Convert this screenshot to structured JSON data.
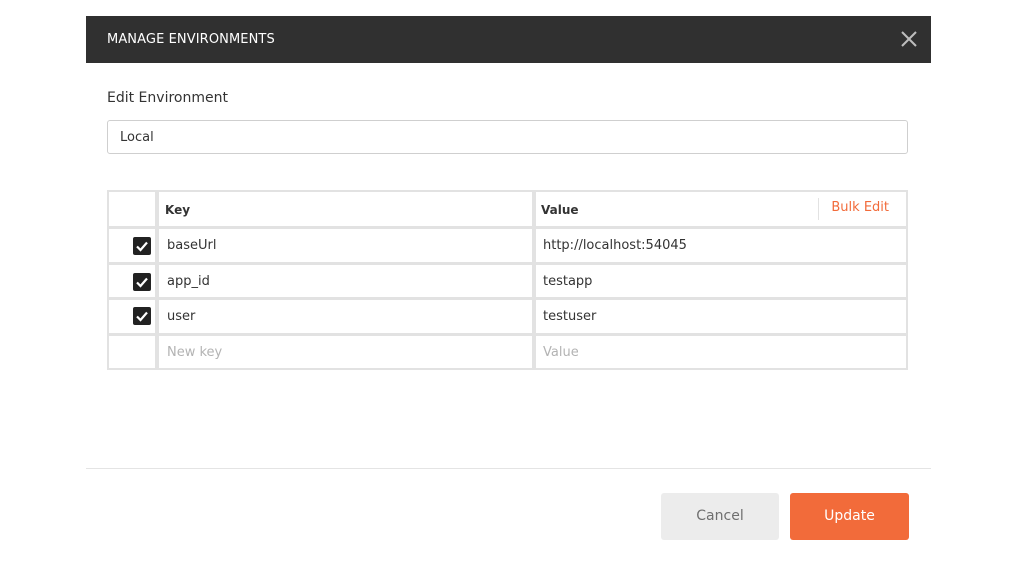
{
  "modal": {
    "title": "MANAGE ENVIRONMENTS",
    "close_icon": "close-icon"
  },
  "form": {
    "section_label": "Edit Environment",
    "env_name_value": "Local"
  },
  "table": {
    "columns": {
      "key": "Key",
      "value": "Value"
    },
    "bulk_edit_label": "Bulk Edit",
    "rows": [
      {
        "enabled": true,
        "key": "baseUrl",
        "value": "http://localhost:54045"
      },
      {
        "enabled": true,
        "key": "app_id",
        "value": "testapp"
      },
      {
        "enabled": true,
        "key": "user",
        "value": "testuser"
      }
    ],
    "new_row": {
      "key_placeholder": "New key",
      "value_placeholder": "Value"
    }
  },
  "footer": {
    "cancel_label": "Cancel",
    "update_label": "Update"
  },
  "colors": {
    "header_bg": "#303030",
    "accent": "#f26b3a",
    "cancel_bg": "#ececec",
    "checkbox": "#222222"
  }
}
